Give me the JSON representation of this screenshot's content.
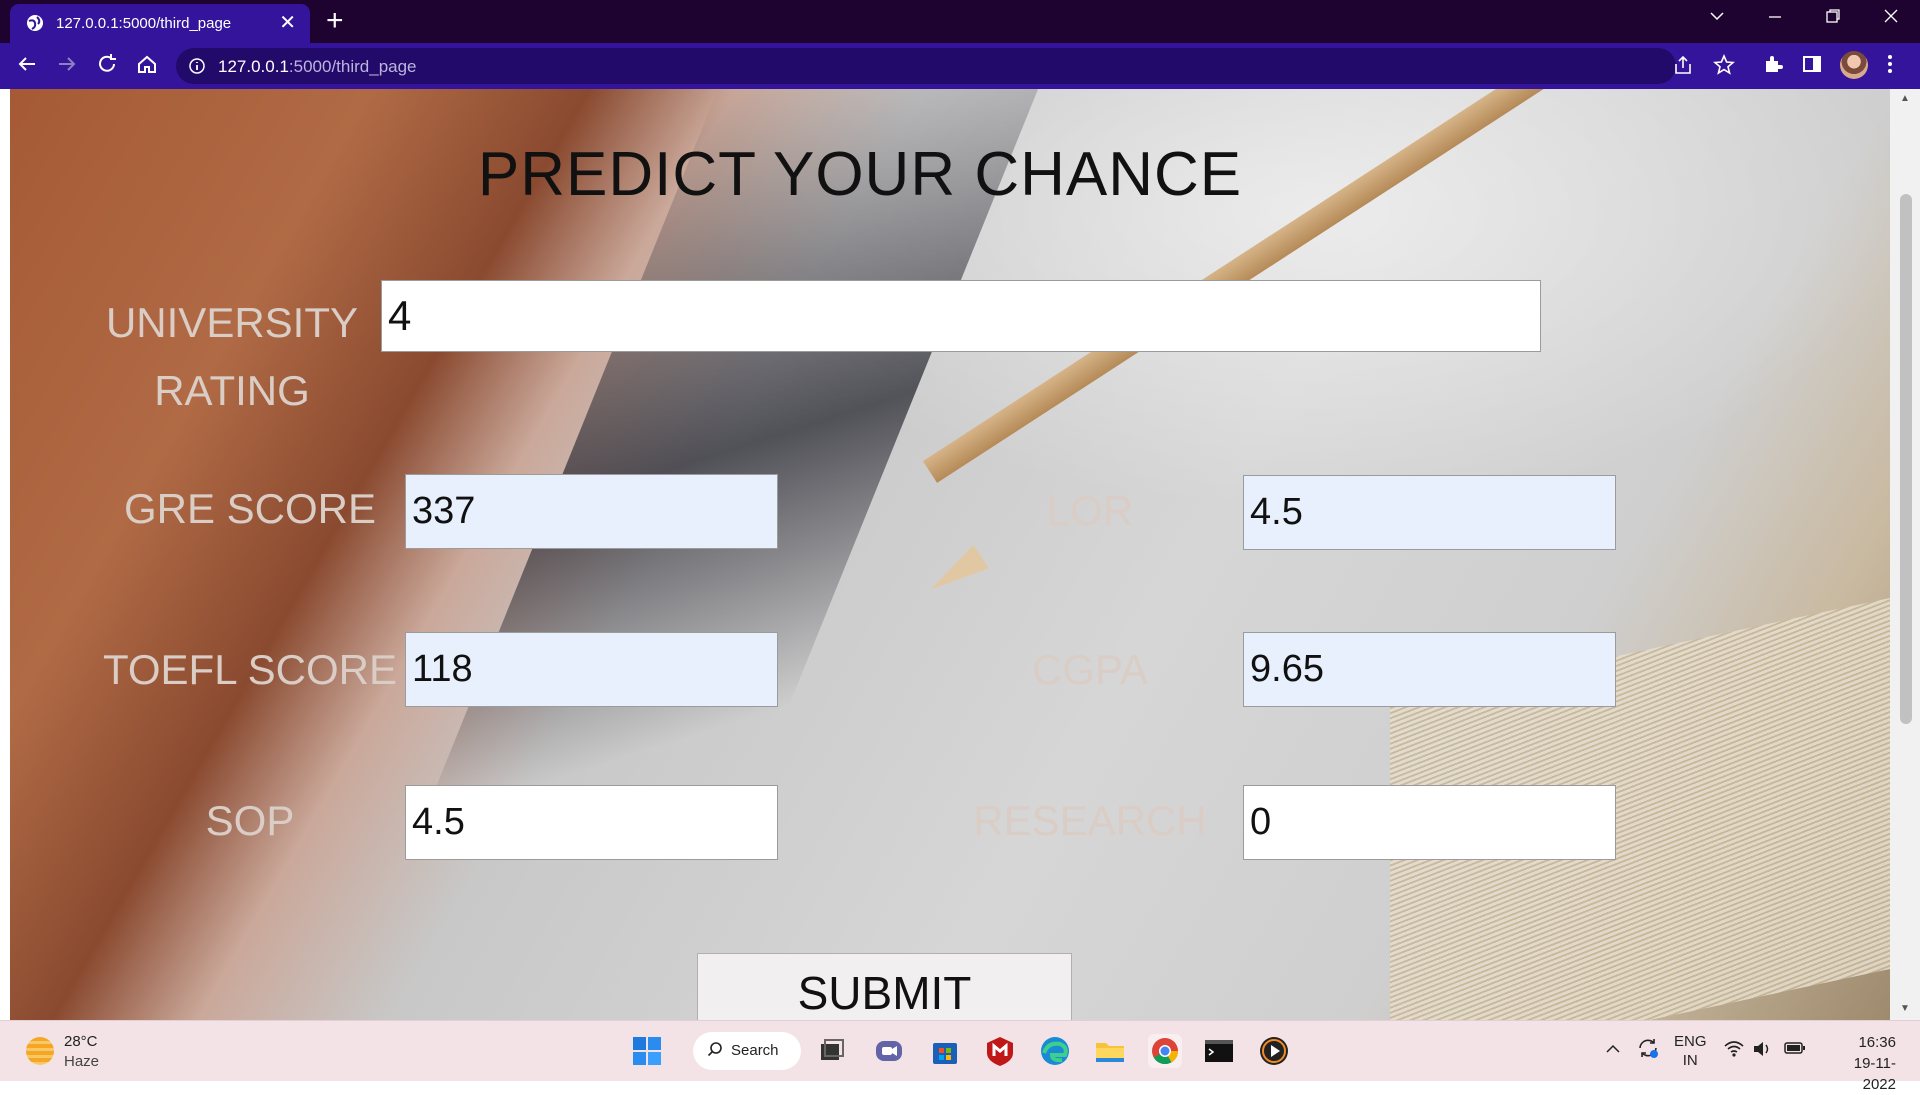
{
  "browser": {
    "tab_title": "127.0.0.1:5000/third_page",
    "tab_close": "✕",
    "new_tab": "+",
    "url_host": "127.0.0.1",
    "url_path": ":5000/third_page"
  },
  "form": {
    "heading": "PREDICT YOUR CHANCE",
    "university_rating": {
      "label_line1": "UNIVERSITY",
      "label_line2": "RATING",
      "value": "4"
    },
    "gre_score": {
      "label": "GRE SCORE",
      "value": "337"
    },
    "lor": {
      "label": "LOR",
      "value": "4.5"
    },
    "toefl_score": {
      "label": "TOEFL SCORE",
      "value": "118"
    },
    "cgpa": {
      "label": "CGPA",
      "value": "9.65"
    },
    "sop": {
      "label": "SOP",
      "value": "4.5"
    },
    "research": {
      "label": "RESEARCH",
      "value": "0"
    },
    "submit_label": "SUBMIT"
  },
  "taskbar": {
    "weather_temp": "28°C",
    "weather_condition": "Haze",
    "search_label": "Search",
    "language_line1": "ENG",
    "language_line2": "IN",
    "time": "16:36",
    "date": "19-11-2022"
  },
  "colors": {
    "tab_bar": "#1e0330",
    "toolbar": "#34149a",
    "autofill_field": "#e8f0fe",
    "label_text": "#d9cdc6"
  }
}
